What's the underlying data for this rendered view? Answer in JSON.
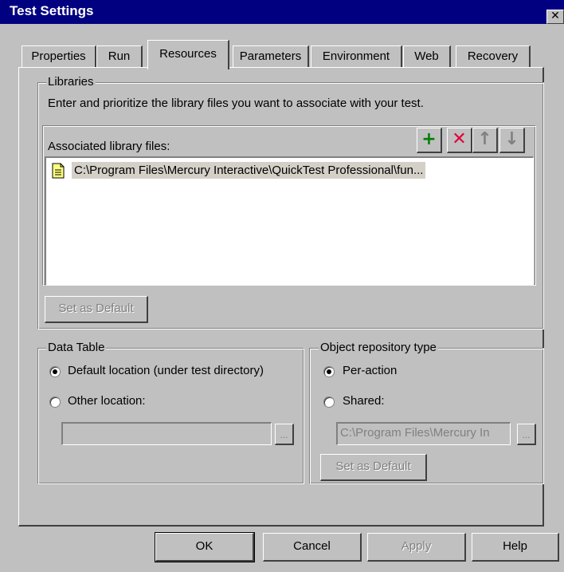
{
  "window": {
    "title": "Test Settings"
  },
  "icons": {
    "close": "close-icon",
    "add": "plus-icon",
    "remove": "x-icon",
    "up": "arrow-up-icon",
    "down": "arrow-down-icon",
    "file": "document-icon"
  },
  "colors": {
    "title_bar": "#000080",
    "add_icon": "#008000",
    "remove_icon": "#e0003c",
    "selection": "#d4d0c8"
  },
  "tabs": [
    {
      "label": "Properties",
      "active": false
    },
    {
      "label": "Run",
      "active": false
    },
    {
      "label": "Resources",
      "active": true
    },
    {
      "label": "Parameters",
      "active": false
    },
    {
      "label": "Environment",
      "active": false
    },
    {
      "label": "Web",
      "active": false
    },
    {
      "label": "Recovery",
      "active": false
    }
  ],
  "libraries": {
    "group_label": "Libraries",
    "description": "Enter and prioritize the library files you want to associate with your test.",
    "list_label": "Associated library files:",
    "files": [
      "C:\\Program Files\\Mercury Interactive\\QuickTest Professional\\fun..."
    ],
    "set_default_label": "Set as Default"
  },
  "data_table": {
    "group_label": "Data Table",
    "default_option": "Default location (under test directory)",
    "other_option": "Other location:",
    "selected": "default",
    "other_path": "",
    "browse_label": "..."
  },
  "object_repository": {
    "group_label": "Object repository type",
    "per_action_option": "Per-action",
    "shared_option": "Shared:",
    "selected": "per-action",
    "shared_path": "C:\\Program Files\\Mercury In",
    "browse_label": "...",
    "set_default_label": "Set as Default"
  },
  "footer": {
    "ok_label": "OK",
    "cancel_label": "Cancel",
    "apply_label": "Apply",
    "help_label": "Help"
  }
}
